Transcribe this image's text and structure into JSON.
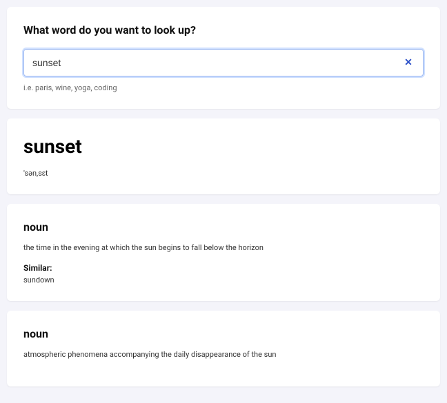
{
  "search": {
    "heading": "What word do you want to look up?",
    "value": "sunset",
    "hint": "i.e. paris, wine, yoga, coding",
    "clear_icon": "✕"
  },
  "result": {
    "word": "sunset",
    "phonetics": "'sən,sɛt"
  },
  "meanings": [
    {
      "part_of_speech": "noun",
      "definition": "the time in the evening at which the sun begins to fall below the horizon",
      "similar_label": "Similar:",
      "synonyms": "sundown"
    },
    {
      "part_of_speech": "noun",
      "definition": "atmospheric phenomena accompanying the daily disappearance of the sun"
    }
  ]
}
